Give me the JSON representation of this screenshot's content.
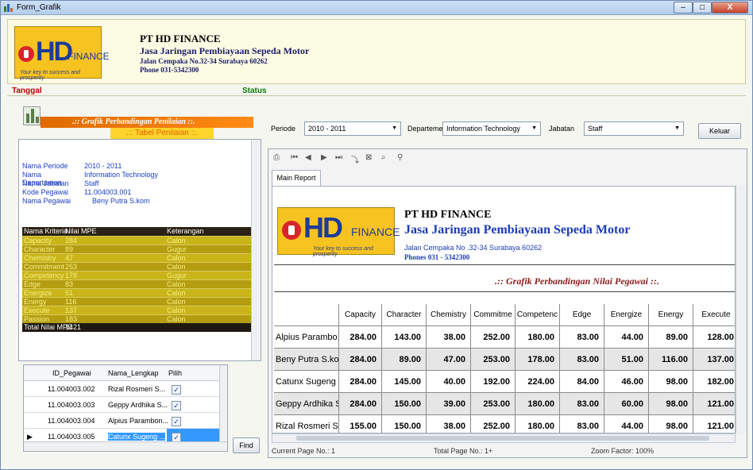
{
  "window": {
    "title": "Form_Grafik",
    "min": "–",
    "max": "□",
    "close": "X"
  },
  "header": {
    "logo": {
      "hd": "HD",
      "finance": "FINANCE",
      "tagline": "Your key to success and prosperity"
    },
    "company": "PT HD FINANCE",
    "subtitle": "Jasa Jaringan Pembiayaan Sepeda Motor",
    "address": "Jalan Cempaka No.32-34 Surabaya 60262",
    "phone": "Phone 031-5342300"
  },
  "statusbar": {
    "tanggal": "Tanggal",
    "status": "Status"
  },
  "left": {
    "grafik_title": ".:: Grafik Perbandingan Penilaian ::.",
    "tabel_title": ".:: Tabel Penilaian ::.",
    "info": [
      {
        "label": "Nama Periode",
        "value": "2010 - 2011"
      },
      {
        "label": "Nama Departemen",
        "value": "Information Technology"
      },
      {
        "label": "Nama Jabatan",
        "value": "Staff"
      },
      {
        "label": "Kode Pegawai",
        "value": "11.004003.001"
      },
      {
        "label": "Nama Pegawai",
        "value": "Beny Putra S.kom"
      }
    ],
    "kriteria_headers": [
      "Nama Kriteria",
      "Nilai MPE",
      "Keterangan"
    ],
    "kriteria": [
      {
        "nama": "Capacity",
        "nilai": "284",
        "ket": "Calon"
      },
      {
        "nama": "Character",
        "nilai": "89",
        "ket": "Gugur"
      },
      {
        "nama": "Chemistry",
        "nilai": "47",
        "ket": "Calon"
      },
      {
        "nama": "Commitment",
        "nilai": "253",
        "ket": "Calon"
      },
      {
        "nama": "Competency",
        "nilai": "178",
        "ket": "Gugur"
      },
      {
        "nama": "Edge",
        "nilai": "83",
        "ket": "Calon"
      },
      {
        "nama": "Energize",
        "nilai": "51",
        "ket": "Calon"
      },
      {
        "nama": "Energy",
        "nilai": "116",
        "ket": "Calon"
      },
      {
        "nama": "Execute",
        "nilai": "137",
        "ket": "Calon"
      },
      {
        "nama": "Passion",
        "nilai": "183",
        "ket": "Calon"
      }
    ],
    "total": {
      "label": "Total Nilai MPE",
      "value": "1421"
    },
    "grid_headers": [
      "ID_Pegawai",
      "Nama_Lengkap",
      "Pilih"
    ],
    "grid": [
      {
        "id": "11.004003.002",
        "nama": "Rizal Rosmeri S...",
        "checked": "✓"
      },
      {
        "id": "11.004003.003",
        "nama": "Geppy Ardhika S...",
        "checked": "✓"
      },
      {
        "id": "11.004003.004",
        "nama": "Alpius Parambon...",
        "checked": "✓"
      },
      {
        "id": "11.004003.005",
        "nama": "Catunx Sugeng ...",
        "checked": "✓"
      }
    ],
    "find_label": "Find"
  },
  "filters": {
    "periode_label": "Periode",
    "periode_value": "2010 - 2011",
    "departemen_label": "Departemen",
    "departemen_value": "Information Technology",
    "jabatan_label": "Jabatan",
    "jabatan_value": "Staff",
    "keluar_label": "Keluar"
  },
  "viewer": {
    "tab": "Main Report",
    "report": {
      "company": "PT HD FINANCE",
      "subtitle": "Jasa Jaringan Pembiayaan Sepeda Motor",
      "address": "Jalan Cempaka No .32-34 Surabaya 60262",
      "phone": "Phones 031 - 5342300",
      "grafik": ".:: Grafik Perbandingan Nilai Pegawai ::."
    },
    "table_headers": [
      "",
      "Capacity",
      "Character",
      "Chemistry",
      "Commitme",
      "Competenc",
      "Edge",
      "Energize",
      "Energy",
      "Execute"
    ],
    "table_rows": [
      [
        "Alpius Parambo",
        "284.00",
        "143.00",
        "38.00",
        "252.00",
        "180.00",
        "83.00",
        "44.00",
        "89.00",
        "128.00"
      ],
      [
        "Beny Putra S.ko",
        "284.00",
        "89.00",
        "47.00",
        "253.00",
        "178.00",
        "83.00",
        "51.00",
        "116.00",
        "137.00"
      ],
      [
        "Catunx Sugeng",
        "284.00",
        "145.00",
        "40.00",
        "192.00",
        "224.00",
        "84.00",
        "46.00",
        "98.00",
        "182.00"
      ],
      [
        "Geppy Ardhika S",
        "284.00",
        "150.00",
        "39.00",
        "253.00",
        "180.00",
        "83.00",
        "60.00",
        "98.00",
        "121.00"
      ],
      [
        "Rizal Rosmeri S",
        "155.00",
        "150.00",
        "38.00",
        "252.00",
        "180.00",
        "83.00",
        "44.00",
        "98.00",
        "121.00"
      ]
    ],
    "footer": {
      "current": "Current Page No.: 1",
      "total": "Total Page No.: 1+",
      "zoom": "Zoom Factor: 100%"
    }
  }
}
